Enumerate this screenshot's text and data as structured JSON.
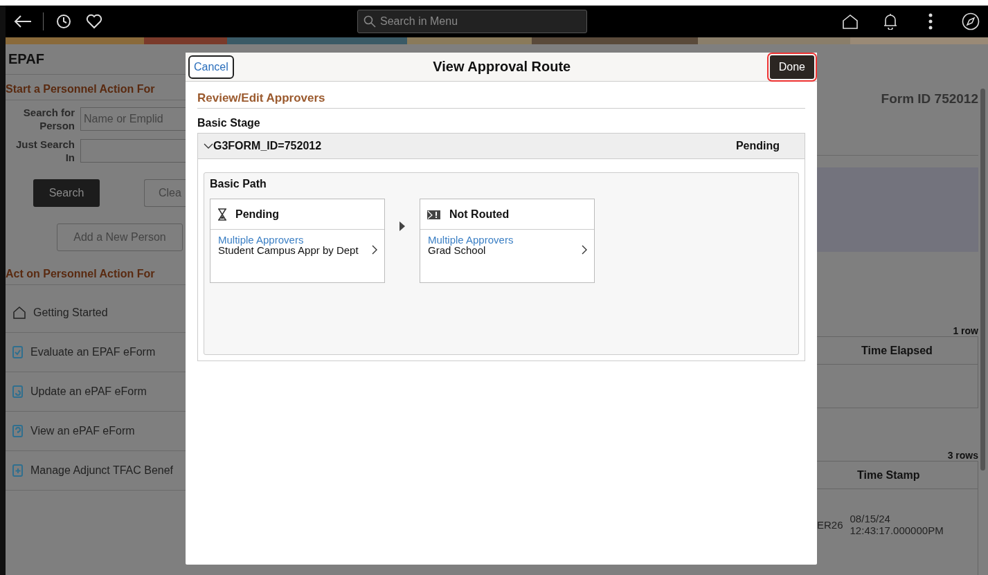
{
  "topbar": {
    "search_placeholder": "Search in Menu"
  },
  "left_panel": {
    "title": "EPAF",
    "start_section": "Start a Personnel Action For",
    "fields": [
      {
        "label": "Search for Person",
        "placeholder": "Name or Emplid"
      },
      {
        "label": "Just Search In"
      }
    ],
    "search_button": "Search",
    "clear_button": "Clea",
    "add_button": "Add a New Person",
    "act_section": "Act on Personnel Action For",
    "items": [
      {
        "kind": "home",
        "label": "Getting Started"
      },
      {
        "kind": "evaluate",
        "label": "Evaluate an EPAF eForm"
      },
      {
        "kind": "update",
        "label": "Update an ePAF eForm"
      },
      {
        "kind": "view",
        "label": "View an ePAF eForm"
      },
      {
        "kind": "add",
        "label": "Manage Adjunct TFAC Benef"
      }
    ]
  },
  "modal": {
    "cancel": "Cancel",
    "title": "View Approval Route",
    "done": "Done",
    "section_title": "Review/Edit Approvers",
    "stage_label": "Basic Stage",
    "stage": {
      "id": "G3FORM_ID=752012",
      "status": "Pending",
      "expanded": true
    },
    "path": {
      "title": "Basic Path",
      "steps": [
        {
          "kind": "pending",
          "status": "Pending",
          "link": "Multiple Approvers",
          "detail": "Student Campus Appr by Dept"
        },
        {
          "kind": "not_routed",
          "status": "Not Routed",
          "link": "Multiple Approvers",
          "detail": "Grad School"
        }
      ]
    }
  },
  "right_panel": {
    "form_id_label": "Form ID",
    "form_id": "752012",
    "grid_1": {
      "count": "1 row",
      "columns": [
        "Time Elapsed"
      ]
    },
    "grid_2": {
      "count": "3 rows",
      "columns": [
        "Time Stamp"
      ],
      "cells": [
        "ER26",
        "08/15/24\n12:43:17.000000PM"
      ]
    }
  }
}
